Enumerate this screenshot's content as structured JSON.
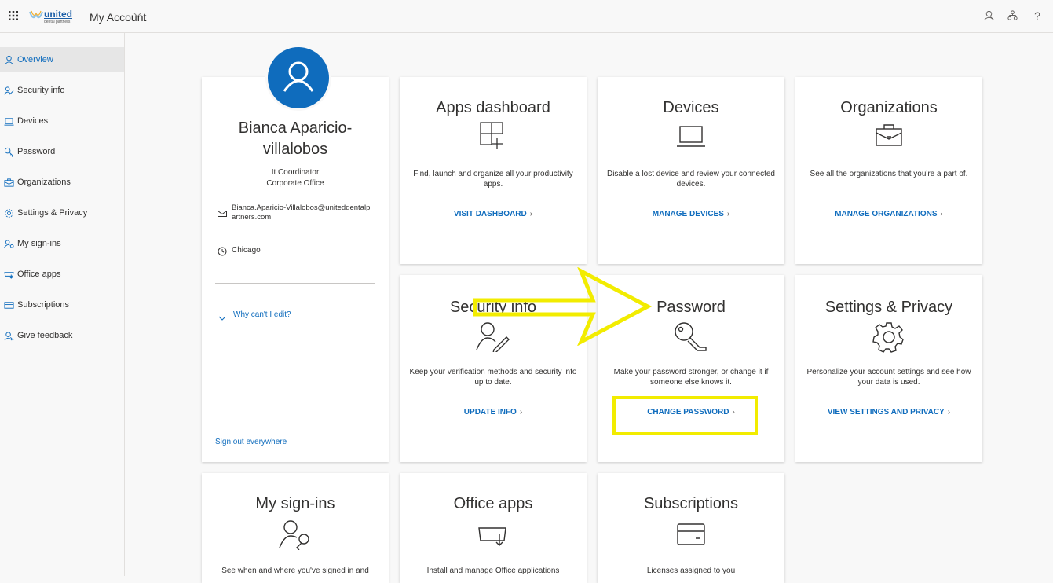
{
  "header": {
    "brand_text": "united",
    "brand_sub": "dental partners",
    "app_title": "My Account",
    "icons": [
      "waffle-icon",
      "feedback-icon",
      "org-icon",
      "help-icon"
    ],
    "help_label": "?"
  },
  "sidebar": {
    "items": [
      {
        "label": "Overview",
        "icon": "person-icon",
        "active": true
      },
      {
        "label": "Security info",
        "icon": "security-info-icon",
        "active": false
      },
      {
        "label": "Devices",
        "icon": "laptop-icon",
        "active": false
      },
      {
        "label": "Password",
        "icon": "key-icon",
        "active": false
      },
      {
        "label": "Organizations",
        "icon": "briefcase-icon",
        "active": false
      },
      {
        "label": "Settings & Privacy",
        "icon": "gear-icon",
        "active": false
      },
      {
        "label": "My sign-ins",
        "icon": "signins-icon",
        "active": false
      },
      {
        "label": "Office apps",
        "icon": "office-apps-icon",
        "active": false
      },
      {
        "label": "Subscriptions",
        "icon": "subscriptions-icon",
        "active": false
      },
      {
        "label": "Give feedback",
        "icon": "feedback-icon",
        "active": false
      }
    ]
  },
  "profile": {
    "name": "Bianca Aparicio-villalobos",
    "job_title": "It Coordinator",
    "department": "Corporate Office",
    "email": "Bianca.Aparicio-Villalobos@uniteddentalpartners.com",
    "city": "Chicago",
    "why_cant_edit": "Why can't I edit?",
    "sign_out": "Sign out everywhere"
  },
  "cards": {
    "apps": {
      "title": "Apps dashboard",
      "desc": "Find, launch and organize all your productivity apps.",
      "link": "VISIT DASHBOARD"
    },
    "devices": {
      "title": "Devices",
      "desc": "Disable a lost device and review your connected devices.",
      "link": "MANAGE DEVICES"
    },
    "organizations": {
      "title": "Organizations",
      "desc": "See all the organizations that you're a part of.",
      "link": "MANAGE ORGANIZATIONS"
    },
    "security": {
      "title": "Security info",
      "desc": "Keep your verification methods and security info up to date.",
      "link": "UPDATE INFO"
    },
    "password": {
      "title": "Password",
      "desc": "Make your password stronger, or change it if someone else knows it.",
      "link": "CHANGE PASSWORD"
    },
    "settings": {
      "title": "Settings & Privacy",
      "desc": "Personalize your account settings and see how your data is used.",
      "link": "VIEW SETTINGS AND PRIVACY"
    },
    "signins": {
      "title": "My sign-ins",
      "desc": "See when and where you've signed in and"
    },
    "office": {
      "title": "Office apps",
      "desc": "Install and manage Office applications"
    },
    "subscriptions": {
      "title": "Subscriptions",
      "desc": "Licenses assigned to you"
    }
  },
  "annotation": {
    "color": "#f2ec00"
  },
  "colors": {
    "accent": "#0f6cbd",
    "background": "#f8f8f8",
    "card": "#ffffff"
  }
}
